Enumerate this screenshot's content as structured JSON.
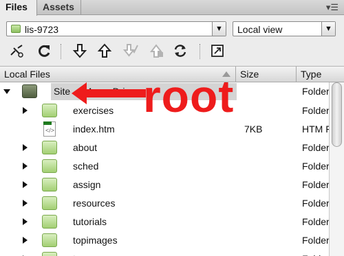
{
  "tabs": [
    {
      "label": "Files"
    },
    {
      "label": "Assets"
    }
  ],
  "panel_menu_icon": "panel-menu-icon",
  "site_select": {
    "value": "lis-9723",
    "icon": "site-folder-icon"
  },
  "view_select": {
    "value": "Local view"
  },
  "toolbar": {
    "buttons": [
      {
        "icon": "connect-icon"
      },
      {
        "icon": "refresh-icon"
      },
      {
        "icon": "get-files-icon"
      },
      {
        "icon": "put-files-icon"
      },
      {
        "icon": "check-out-icon"
      },
      {
        "icon": "check-in-icon"
      },
      {
        "icon": "synchronize-icon"
      },
      {
        "icon": "expand-panel-icon"
      }
    ]
  },
  "columns": {
    "name": "Local Files",
    "size": "Size",
    "type": "Type"
  },
  "rows": [
    {
      "name": "Site ... Mac... Drive...",
      "size": "",
      "type": "Folder",
      "kind": "site",
      "expanded": true
    },
    {
      "name": "exercises",
      "size": "",
      "type": "Folder",
      "kind": "folder"
    },
    {
      "name": "index.htm",
      "size": "7KB",
      "type": "HTM F",
      "kind": "file"
    },
    {
      "name": "about",
      "size": "",
      "type": "Folder",
      "kind": "folder"
    },
    {
      "name": "sched",
      "size": "",
      "type": "Folder",
      "kind": "folder"
    },
    {
      "name": "assign",
      "size": "",
      "type": "Folder",
      "kind": "folder"
    },
    {
      "name": "resources",
      "size": "",
      "type": "Folder",
      "kind": "folder"
    },
    {
      "name": "tutorials",
      "size": "",
      "type": "Folder",
      "kind": "folder"
    },
    {
      "name": "topimages",
      "size": "",
      "type": "Folder",
      "kind": "folder"
    },
    {
      "name": "t...",
      "size": "",
      "type": "Folder",
      "kind": "folder"
    }
  ],
  "annotation": {
    "text": "root",
    "color": "#ee1c1c"
  }
}
